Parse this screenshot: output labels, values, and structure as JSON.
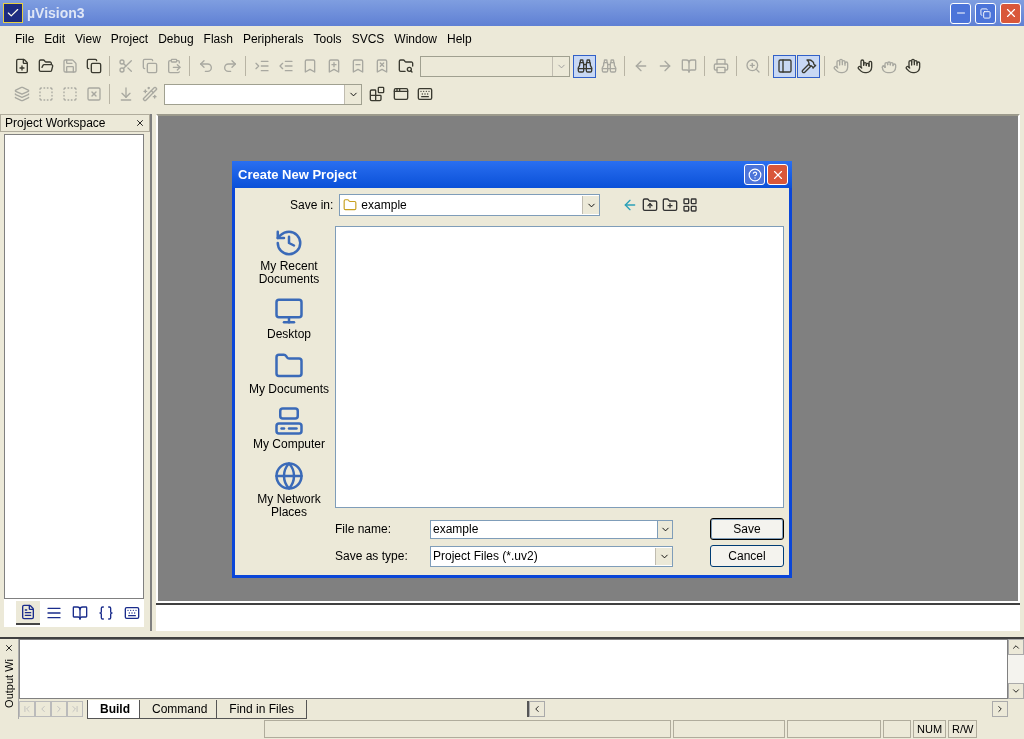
{
  "window": {
    "title": "µVision3"
  },
  "menu": [
    {
      "label": "File"
    },
    {
      "label": "Edit"
    },
    {
      "label": "View"
    },
    {
      "label": "Project"
    },
    {
      "label": "Debug"
    },
    {
      "label": "Flash"
    },
    {
      "label": "Peripherals"
    },
    {
      "label": "Tools"
    },
    {
      "label": "SVCS"
    },
    {
      "label": "Window"
    },
    {
      "label": "Help"
    }
  ],
  "toolbar_1": [
    {
      "kind": "new-file",
      "disabled": false,
      "pressed": false
    },
    {
      "kind": "open",
      "disabled": false,
      "pressed": false
    },
    {
      "kind": "save",
      "disabled": true,
      "pressed": false
    },
    {
      "kind": "save-all",
      "disabled": false,
      "pressed": false
    },
    {
      "kind": "sep"
    },
    {
      "kind": "cut",
      "disabled": true,
      "pressed": false
    },
    {
      "kind": "copy",
      "disabled": true,
      "pressed": false
    },
    {
      "kind": "paste",
      "disabled": true,
      "pressed": false
    },
    {
      "kind": "sep"
    },
    {
      "kind": "undo",
      "disabled": true,
      "pressed": false
    },
    {
      "kind": "redo",
      "disabled": true,
      "pressed": false
    },
    {
      "kind": "sep"
    },
    {
      "kind": "indent",
      "disabled": true,
      "pressed": false
    },
    {
      "kind": "outdent",
      "disabled": true,
      "pressed": false
    },
    {
      "kind": "bookmark",
      "disabled": true,
      "pressed": false
    },
    {
      "kind": "bookmark-next",
      "disabled": true,
      "pressed": false
    },
    {
      "kind": "bookmark-prev",
      "disabled": true,
      "pressed": false
    },
    {
      "kind": "bookmark-clear",
      "disabled": true,
      "pressed": false
    },
    {
      "kind": "find-in-files",
      "disabled": false,
      "pressed": false
    },
    {
      "kind": "combo",
      "disabled": true
    },
    {
      "kind": "find",
      "disabled": false,
      "pressed": true
    },
    {
      "kind": "find-next",
      "disabled": true,
      "pressed": false
    },
    {
      "kind": "sep"
    },
    {
      "kind": "back",
      "disabled": true,
      "pressed": false
    },
    {
      "kind": "forward",
      "disabled": true,
      "pressed": false
    },
    {
      "kind": "browse",
      "disabled": true,
      "pressed": false
    },
    {
      "kind": "sep"
    },
    {
      "kind": "print",
      "disabled": true,
      "pressed": false
    },
    {
      "kind": "sep"
    },
    {
      "kind": "zoom",
      "disabled": true,
      "pressed": false
    },
    {
      "kind": "sep"
    },
    {
      "kind": "workspace-window",
      "disabled": false,
      "pressed": true
    },
    {
      "kind": "output-window",
      "disabled": false,
      "pressed": true
    },
    {
      "kind": "sep"
    },
    {
      "kind": "hand",
      "disabled": true,
      "pressed": false
    },
    {
      "kind": "hand-cross",
      "disabled": false,
      "pressed": false
    },
    {
      "kind": "grab",
      "disabled": true,
      "pressed": false
    },
    {
      "kind": "hand",
      "disabled": false,
      "pressed": false
    }
  ],
  "toolbar_2": [
    {
      "kind": "translate",
      "disabled": true,
      "pressed": false
    },
    {
      "kind": "build",
      "disabled": true,
      "pressed": false
    },
    {
      "kind": "rebuild",
      "disabled": true,
      "pressed": false
    },
    {
      "kind": "stop",
      "disabled": true,
      "pressed": false
    },
    {
      "kind": "sep"
    },
    {
      "kind": "load",
      "disabled": true,
      "pressed": false
    },
    {
      "kind": "wand",
      "disabled": true,
      "pressed": false
    },
    {
      "kind": "combo",
      "disabled": false
    },
    {
      "kind": "blocks",
      "disabled": false,
      "pressed": false
    },
    {
      "kind": "windows",
      "disabled": false,
      "pressed": false
    },
    {
      "kind": "keyboard",
      "disabled": false,
      "pressed": false
    }
  ],
  "workspace": {
    "title": "Project Workspace",
    "tabs": [
      {
        "kind": "files",
        "selected": true
      },
      {
        "kind": "regs",
        "selected": false
      },
      {
        "kind": "books",
        "selected": false
      },
      {
        "kind": "functions",
        "selected": false
      },
      {
        "kind": "templates",
        "selected": false
      }
    ]
  },
  "dialog": {
    "title": "Create New Project",
    "save_in": {
      "label": "Save in:",
      "value": "example"
    },
    "places": [
      {
        "kind": "recent",
        "label": "My Recent Documents"
      },
      {
        "kind": "desktop",
        "label": "Desktop"
      },
      {
        "kind": "documents",
        "label": "My Documents"
      },
      {
        "kind": "computer",
        "label": "My Computer"
      },
      {
        "kind": "network",
        "label": "My Network Places"
      }
    ],
    "file_name": {
      "label": "File name:",
      "value": "example"
    },
    "save_as_type": {
      "label": "Save as type:",
      "value": "Project Files (*.uv2)"
    },
    "buttons": [
      {
        "label": "Save",
        "default": true
      },
      {
        "label": "Cancel",
        "default": false
      }
    ]
  },
  "output": {
    "title": "Output Wi",
    "tabs": [
      {
        "label": "Build",
        "selected": true
      },
      {
        "label": "Command",
        "selected": false
      },
      {
        "label": "Find in Files",
        "selected": false
      }
    ]
  },
  "status_bar": {
    "panels": [
      {
        "text": "NUM"
      },
      {
        "text": "R/W"
      }
    ]
  }
}
